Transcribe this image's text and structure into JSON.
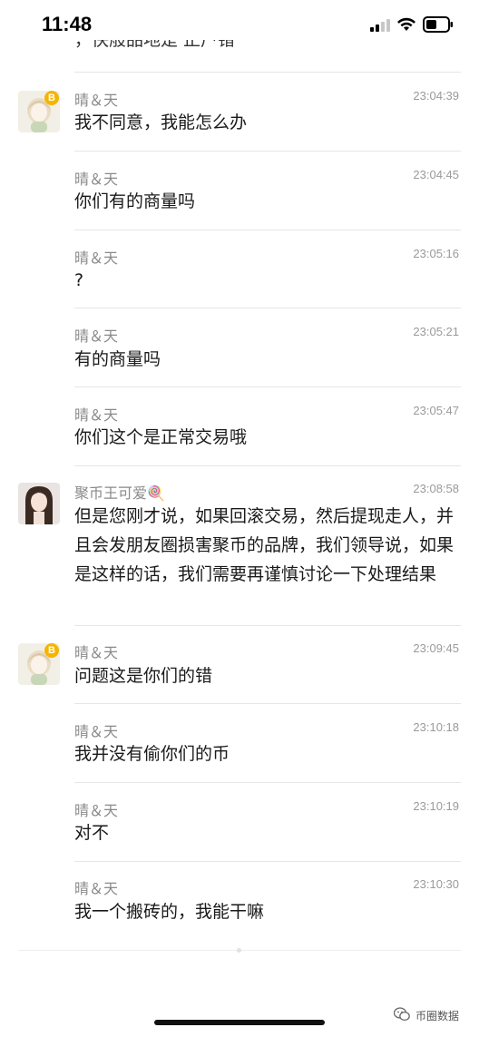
{
  "status_bar": {
    "time": "11:48"
  },
  "cutoff_text": "，快般品地是 正户错",
  "messages": [
    {
      "name": "晴＆天",
      "time": "23:04:39",
      "text": "我不同意，我能怎么办",
      "avatar": "user-avatar"
    },
    {
      "name": "晴＆天",
      "time": "23:04:45",
      "text": "你们有的商量吗"
    },
    {
      "name": "晴＆天",
      "time": "23:05:16",
      "text": "?"
    },
    {
      "name": "晴＆天",
      "time": "23:05:21",
      "text": "有的商量吗"
    },
    {
      "name": "晴＆天",
      "time": "23:05:47",
      "text": "你们这个是正常交易哦"
    },
    {
      "name": "聚币王可爱🍭",
      "time": "23:08:58",
      "text": "但是您刚才说，如果回滚交易，然后提现走人，并且会发朋友圈损害聚币的品牌，我们领导说，如果是这样的话，我们需要再谨慎讨论一下处理结果",
      "avatar": "agent-avatar"
    },
    {
      "name": "晴＆天",
      "time": "23:09:45",
      "text": "问题这是你们的错",
      "avatar": "user-avatar"
    },
    {
      "name": "晴＆天",
      "time": "23:10:18",
      "text": "我并没有偷你们的币"
    },
    {
      "name": "晴＆天",
      "time": "23:10:19",
      "text": "对不"
    },
    {
      "name": "晴＆天",
      "time": "23:10:30",
      "text": "我一个搬砖的，我能干嘛"
    }
  ],
  "watermark": "币圈数据",
  "colors": {
    "badge": "#f4b400",
    "divider": "#e6e6e6",
    "name_gray": "#8a8a8a"
  }
}
